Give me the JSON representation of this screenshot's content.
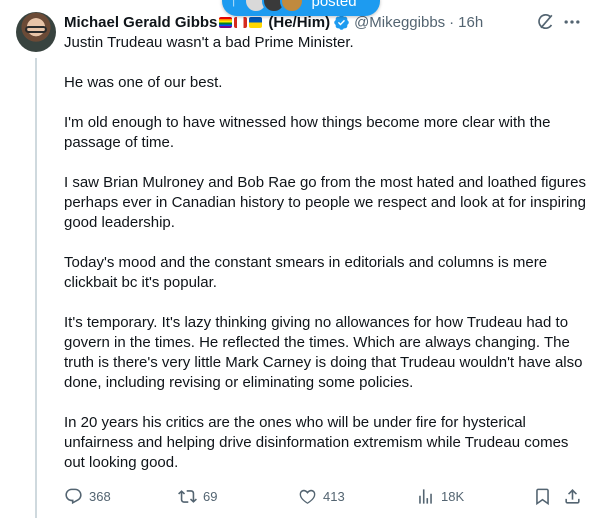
{
  "post": {
    "author_name": "Michael Gerald Gibbs",
    "pronouns": "(He/Him)",
    "handle": "@Mikeggibbs",
    "separator": "·",
    "time": "16h",
    "paragraphs": [
      "Justin Trudeau wasn't a bad Prime Minister.",
      "He was one of our best.",
      "I'm old enough to have witnessed how things become more clear with the passage of time.",
      "I saw Brian Mulroney and Bob Rae go from the most hated and loathed figures perhaps ever in Canadian history to people we respect and look at for inspiring good leadership.",
      "Today's mood and the constant smears in editorials and columns is mere clickbait bc it's popular.",
      "It's temporary. It's lazy thinking giving no allowances for how Trudeau had to govern in the times. He reflected the times. Which are always changing. The truth is there's very little Mark Carney is doing that Trudeau wouldn't have also done, including revising or eliminating some policies.",
      "In 20 years his critics are the ones who will be under fire for hysterical unfairness and helping drive disinformation extremism while Trudeau comes out looking good."
    ]
  },
  "new_posts_pill": {
    "arrow": "↑",
    "label": "posted"
  },
  "actions": {
    "replies": "368",
    "reposts": "69",
    "likes": "413",
    "views": "18K"
  },
  "colors": {
    "accent": "#1d9bf0",
    "text": "#0f1419",
    "secondary": "#536471"
  }
}
